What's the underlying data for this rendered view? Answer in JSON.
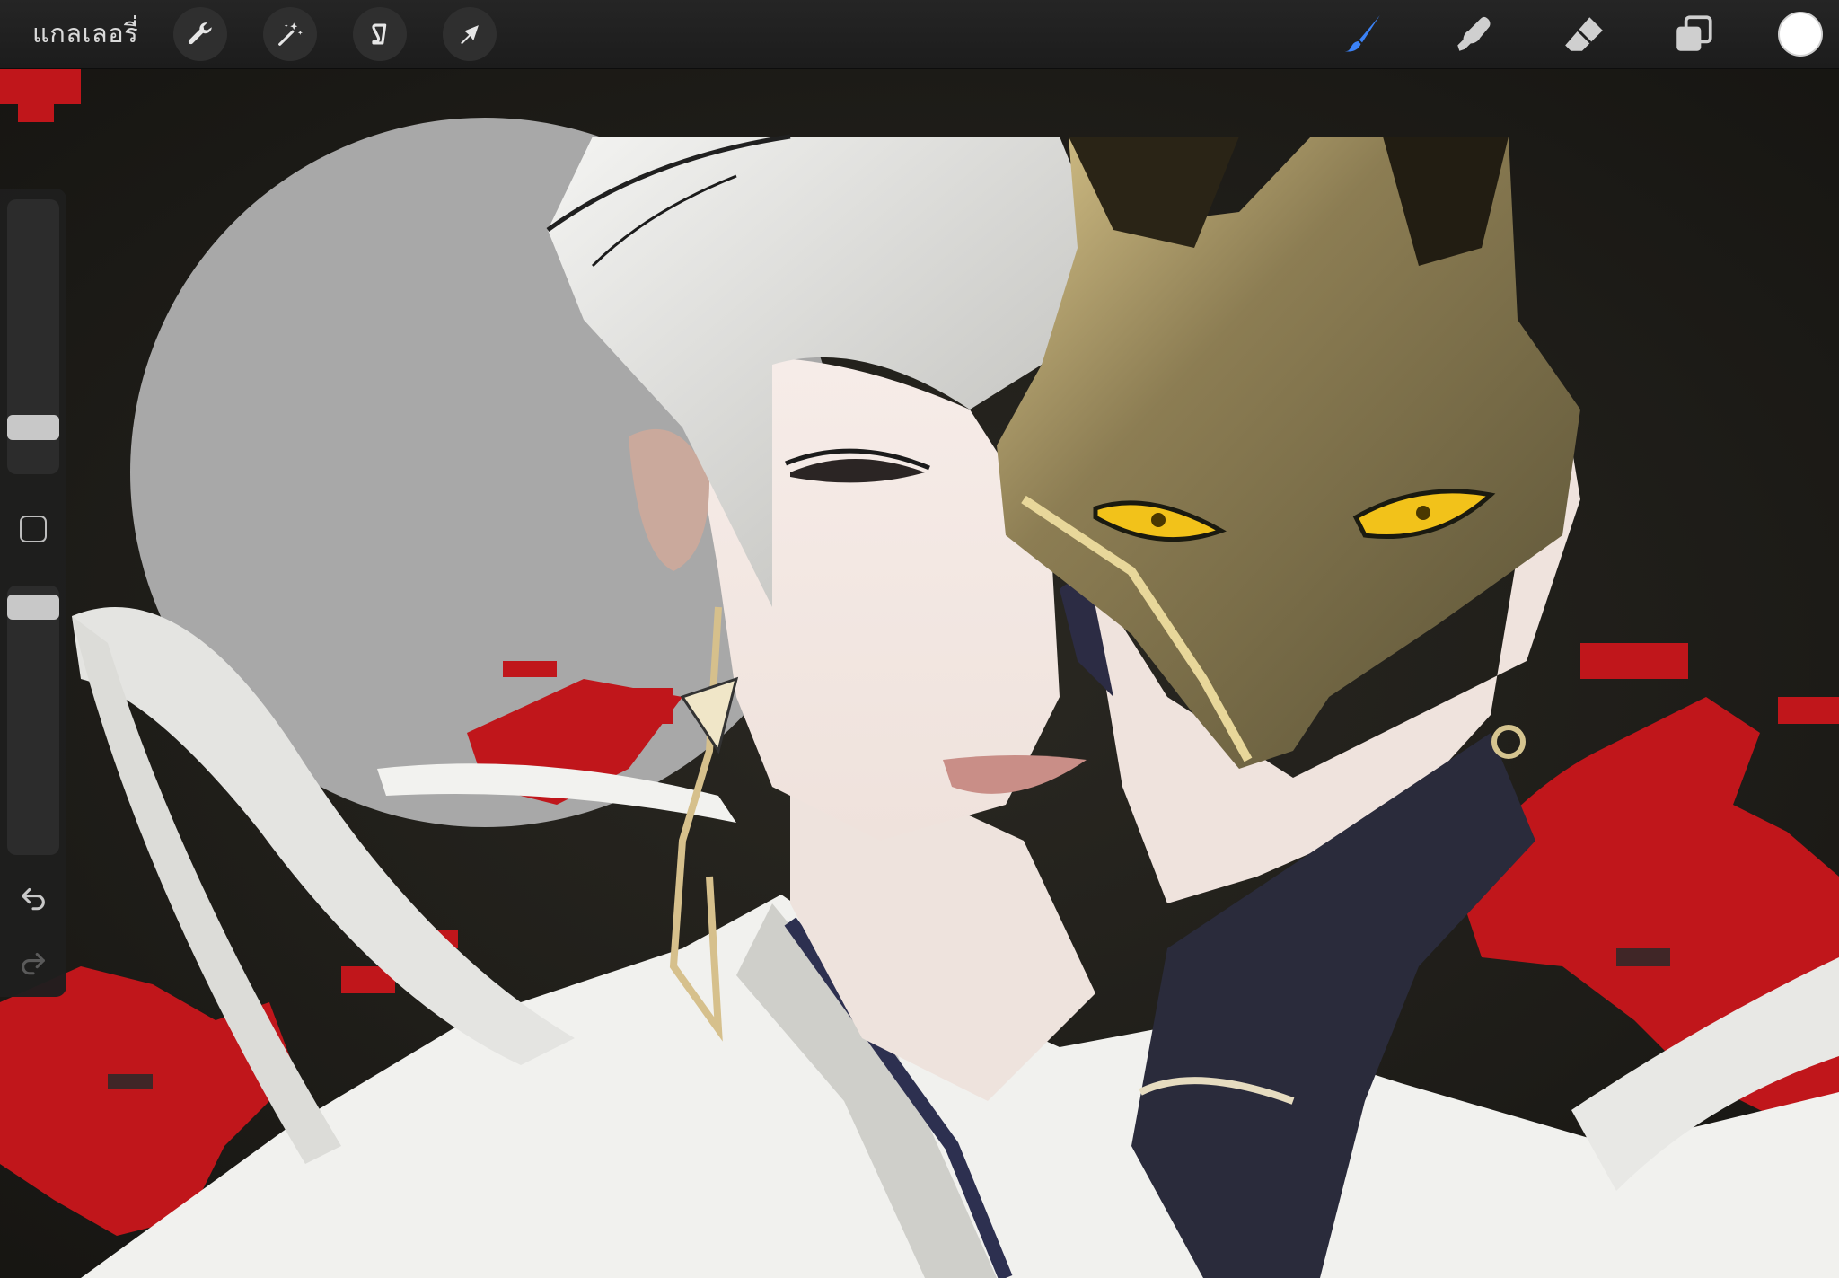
{
  "topbar": {
    "gallery_label": "แกลเลอรี่",
    "left_tools": [
      {
        "icon": "wrench-icon",
        "name": "actions"
      },
      {
        "icon": "magic-wand-icon",
        "name": "adjustments"
      },
      {
        "icon": "selection-s-icon",
        "name": "selection"
      },
      {
        "icon": "arrow-cursor-icon",
        "name": "transform"
      }
    ],
    "right_tools": [
      {
        "icon": "brush-icon",
        "name": "paint",
        "active": true
      },
      {
        "icon": "smudge-finger-icon",
        "name": "smudge",
        "active": false
      },
      {
        "icon": "eraser-icon",
        "name": "erase",
        "active": false
      },
      {
        "icon": "layers-icon",
        "name": "layers",
        "active": false
      }
    ],
    "current_color": "#ffffff",
    "active_tool_color": "#3b82f6"
  },
  "sidebar": {
    "brush_size_level": 0.12,
    "opacity_level": 0.95,
    "undo_icon": "undo-arrow-icon",
    "redo_icon": "redo-arrow-icon",
    "modify_icon": "square-modify-icon"
  },
  "canvas": {
    "background_color": "#1c1b17",
    "moon_color": "#a8a8a8",
    "accent_red": "#c0161b",
    "mask_color": "#6d6443",
    "mask_eye_color": "#f2c21a"
  }
}
